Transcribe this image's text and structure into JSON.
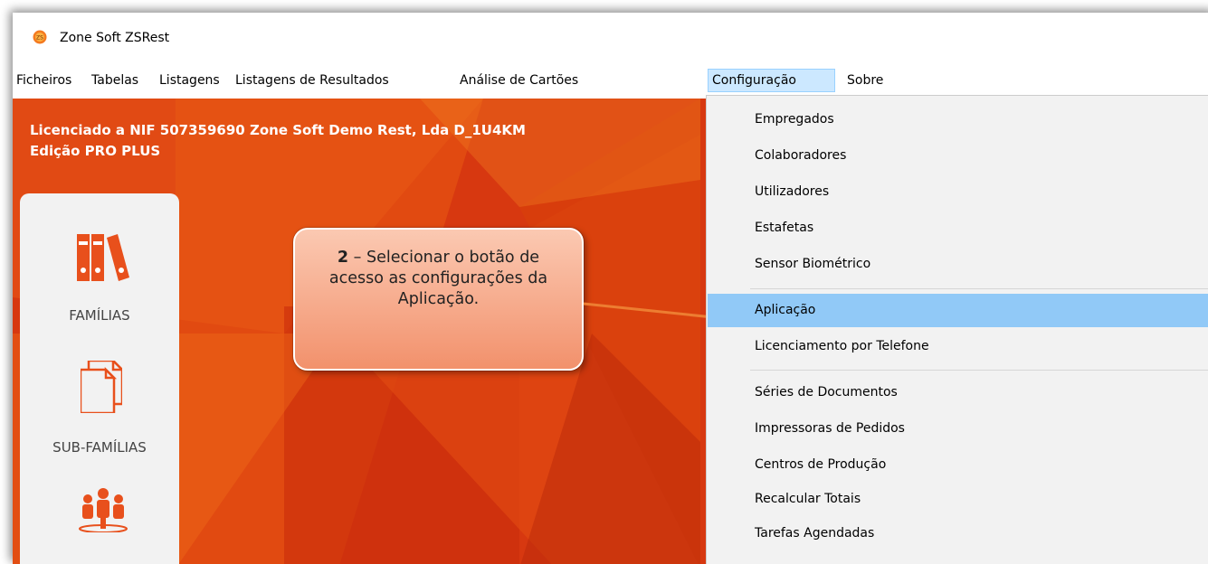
{
  "window": {
    "title": "Zone Soft ZSRest",
    "logo_icon": "zonesoft-logo-icon"
  },
  "menubar": {
    "items": [
      {
        "label": "Ficheiros"
      },
      {
        "label": "Tabelas"
      },
      {
        "label": "Listagens"
      },
      {
        "label": "Listagens de Resultados"
      },
      {
        "label": "Análise de Cartões"
      },
      {
        "label": "Configuração",
        "active": true
      },
      {
        "label": "Sobre"
      }
    ]
  },
  "license": {
    "line1": "Licenciado a NIF 507359690 Zone Soft Demo Rest, Lda D_1U4KM",
    "line2": "Edição PRO PLUS"
  },
  "side_panel": {
    "items": [
      {
        "label": "FAMÍLIAS",
        "icon": "binders-icon"
      },
      {
        "label": "SUB-FAMÍLIAS",
        "icon": "documents-icon"
      },
      {
        "label": "",
        "icon": "people-icon"
      }
    ]
  },
  "callout": {
    "number": "2",
    "text": " – Selecionar o botão de acesso as configurações da Aplicação."
  },
  "dropdown": {
    "items": [
      {
        "label": "Empregados"
      },
      {
        "label": "Colaboradores"
      },
      {
        "label": "Utilizadores"
      },
      {
        "label": "Estafetas"
      },
      {
        "label": "Sensor Biométrico"
      },
      {
        "label": "Aplicação",
        "highlighted": true
      },
      {
        "label": "Licenciamento por Telefone"
      },
      {
        "label": "Séries de Documentos"
      },
      {
        "label": "Impressoras de Pedidos"
      },
      {
        "label": "Centros de Produção"
      },
      {
        "label": "Recalcular Totais"
      },
      {
        "label": "Tarefas Agendadas"
      }
    ]
  },
  "colors": {
    "accent_orange": "#e8501c",
    "menu_active_bg": "#cce8ff",
    "dropdown_highlight": "#91c9f7",
    "callout_fill": "#f2916c",
    "arrow": "#ed7d31"
  }
}
